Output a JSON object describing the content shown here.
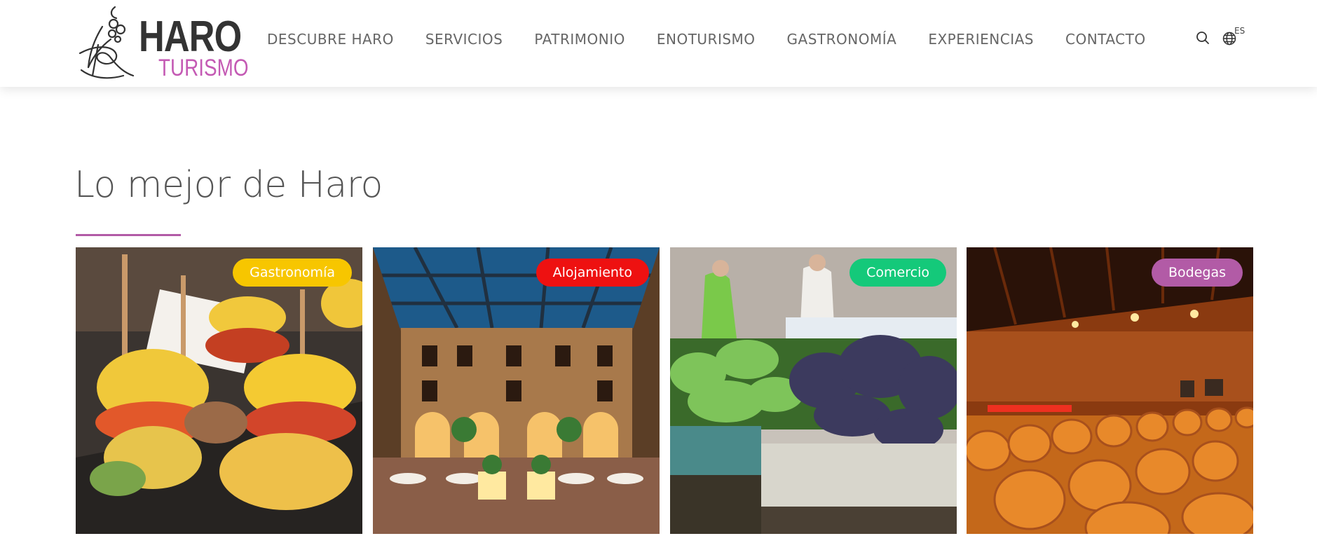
{
  "header": {
    "logo": {
      "title": "HARO",
      "subtitle": "TURISMO"
    },
    "nav": [
      {
        "label": "DESCUBRE HARO"
      },
      {
        "label": "SERVICIOS"
      },
      {
        "label": "PATRIMONIO"
      },
      {
        "label": "ENOTURISMO"
      },
      {
        "label": "GASTRONOMÍA"
      },
      {
        "label": "EXPERIENCIAS"
      },
      {
        "label": "CONTACTO"
      }
    ],
    "search_icon": "search-icon",
    "language": {
      "icon": "globe-icon",
      "label": "ES"
    }
  },
  "main": {
    "title": "Lo mejor de Haro",
    "accent_color": "#b25ba6",
    "cards": [
      {
        "category": "Gastronomía",
        "badge_color": "#f7c600",
        "image": "tapas food photo"
      },
      {
        "category": "Alojamiento",
        "badge_color": "#ee1111",
        "image": "hotel courtyard photo"
      },
      {
        "category": "Comercio",
        "badge_color": "#14c97a",
        "image": "market greens photo"
      },
      {
        "category": "Bodegas",
        "badge_color": "#b25ba6",
        "image": "wine barrels cellar photo"
      }
    ]
  }
}
